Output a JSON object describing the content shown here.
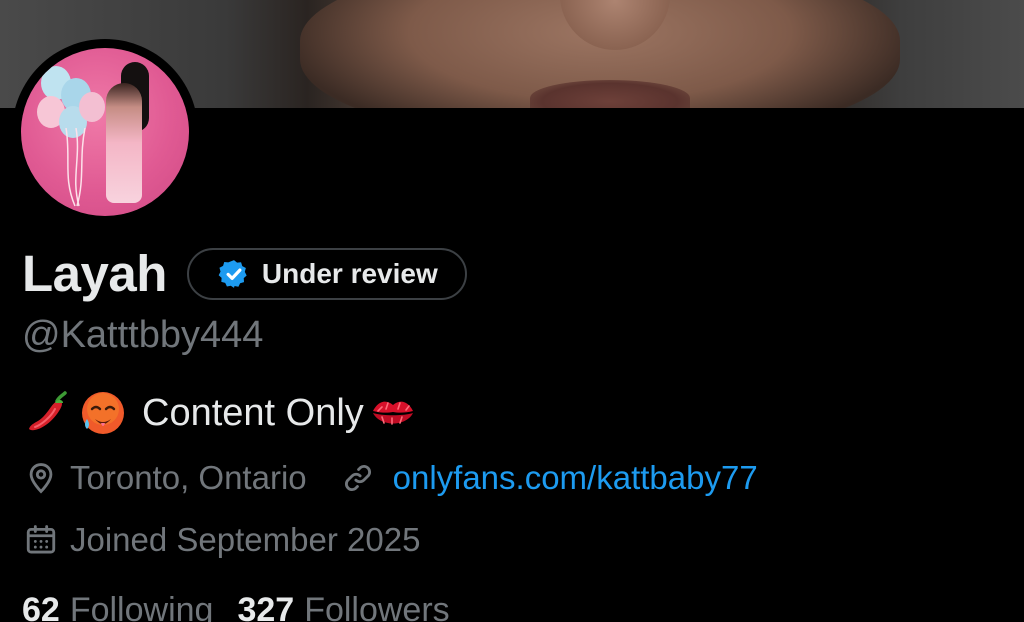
{
  "colors": {
    "background": "#000000",
    "primary_text": "#e7e9ea",
    "secondary_text": "#71767b",
    "link": "#1d9bf0",
    "verified_badge": "#1d9bf0",
    "pill_border": "#3c4044"
  },
  "profile": {
    "display_name": "Layah",
    "verification_label": "Under review",
    "handle": "@Katttbby444",
    "bio": {
      "leading_emojis": [
        "hot-pepper-emoji",
        "hot-face-emoji"
      ],
      "text": "Content Only",
      "trailing_emoji": "kiss-mark-emoji"
    },
    "location": "Toronto, Ontario",
    "website": "onlyfans.com/kattbaby77",
    "joined": "Joined September 2025"
  },
  "stats": {
    "following_count": "62",
    "following_label": "Following",
    "followers_count": "327",
    "followers_label": "Followers"
  },
  "icons": {
    "location": "location-pin-icon",
    "link": "link-icon",
    "calendar": "calendar-icon",
    "verified": "verified-badge-icon"
  }
}
